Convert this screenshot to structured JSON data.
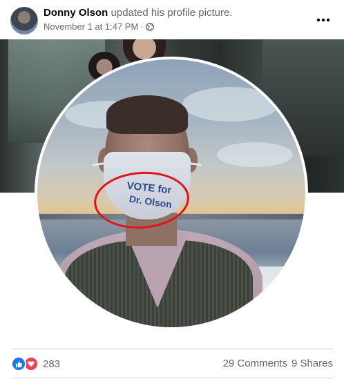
{
  "post": {
    "author": "Donny Olson",
    "action": "updated his profile picture.",
    "date": "November 1 at 1:47 PM",
    "privacy_icon": "globe-icon",
    "more_icon": "more-horizontal-icon"
  },
  "photo": {
    "mask_line1": "VOTE for",
    "mask_line2": "Dr. Olson",
    "annotation_color": "#e0121b"
  },
  "footer": {
    "reaction_icons": [
      "like-icon",
      "love-icon"
    ],
    "reaction_count": "283",
    "comments": "29 Comments",
    "shares": "9 Shares"
  },
  "colors": {
    "like": "#1877f2",
    "love": "#f33e58",
    "secondary_text": "#65676b"
  }
}
